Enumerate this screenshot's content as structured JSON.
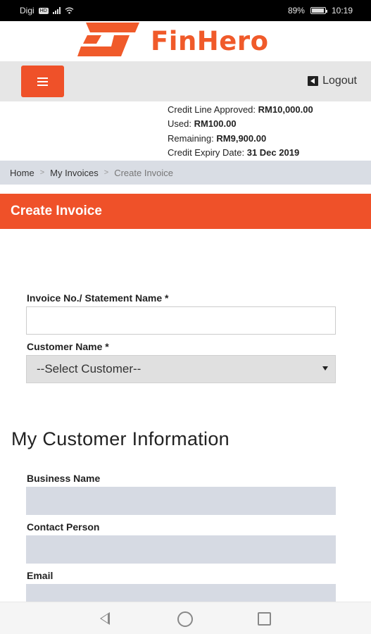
{
  "status_bar": {
    "carrier": "Digi",
    "carrier_badge": "HD",
    "battery": "89%",
    "time": "10:19"
  },
  "header": {
    "brand": "FinHero",
    "logo_icon": "finhero-logo-icon",
    "logout_label": "Logout"
  },
  "credit": {
    "approved_label": "Credit Line Approved:",
    "approved_value": "RM10,000.00",
    "used_label": "Used:",
    "used_value": "RM100.00",
    "remaining_label": "Remaining:",
    "remaining_value": "RM9,900.00",
    "expiry_label": "Credit Expiry Date:",
    "expiry_value": "31 Dec 2019"
  },
  "breadcrumb": {
    "items": [
      "Home",
      "My Invoices",
      "Create Invoice"
    ],
    "separator": ">"
  },
  "page": {
    "title": "Create Invoice"
  },
  "form": {
    "invoice_label": "Invoice No./ Statement Name *",
    "invoice_value": "",
    "customer_label": "Customer Name *",
    "customer_selected": "--Select Customer--"
  },
  "customer_info": {
    "heading": "My Customer Information",
    "business_name_label": "Business Name",
    "contact_person_label": "Contact Person",
    "email_label": "Email"
  },
  "colors": {
    "brand_orange": "#ef5129",
    "breadcrumb_bg": "#d9dde4",
    "readonly_field_bg": "#d6dae3"
  }
}
